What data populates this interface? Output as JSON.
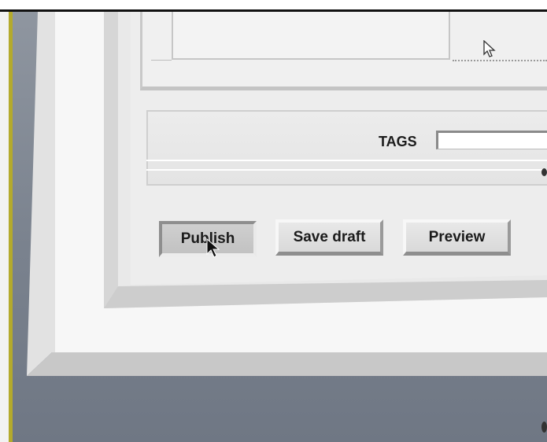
{
  "tags": {
    "label": "TAGS",
    "value": ""
  },
  "buttons": {
    "publish": "Publish",
    "save_draft": "Save draft",
    "preview": "Preview"
  }
}
